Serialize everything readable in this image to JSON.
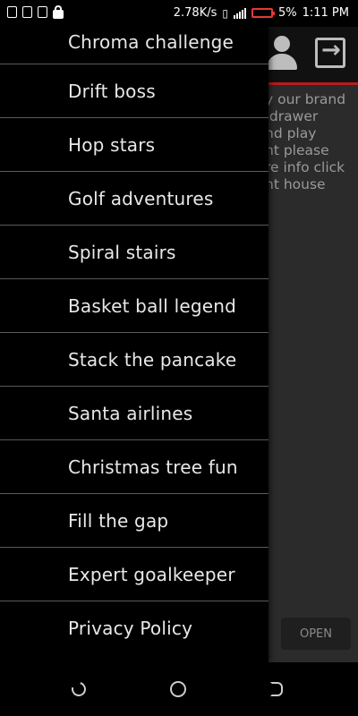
{
  "status_bar": {
    "speed": "2.78K/s",
    "battery": "5%",
    "time": "1:11 PM"
  },
  "app": {
    "background_text": "y our brand\n drawer\nnd play\nnt please\nre info click\nnt house",
    "open_button": "OPEN"
  },
  "drawer": {
    "items": [
      {
        "label": "Chroma challenge"
      },
      {
        "label": "Drift boss"
      },
      {
        "label": "Hop stars"
      },
      {
        "label": "Golf adventures"
      },
      {
        "label": "Spiral stairs"
      },
      {
        "label": "Basket ball legend"
      },
      {
        "label": "Stack the pancake"
      },
      {
        "label": "Santa airlines"
      },
      {
        "label": "Christmas tree fun"
      },
      {
        "label": "Fill the gap"
      },
      {
        "label": "Expert goalkeeper"
      },
      {
        "label": "Privacy Policy"
      }
    ]
  },
  "colors": {
    "accent": "#b71c1c",
    "battery_low": "#e53935",
    "drawer_bg": "#000000"
  }
}
